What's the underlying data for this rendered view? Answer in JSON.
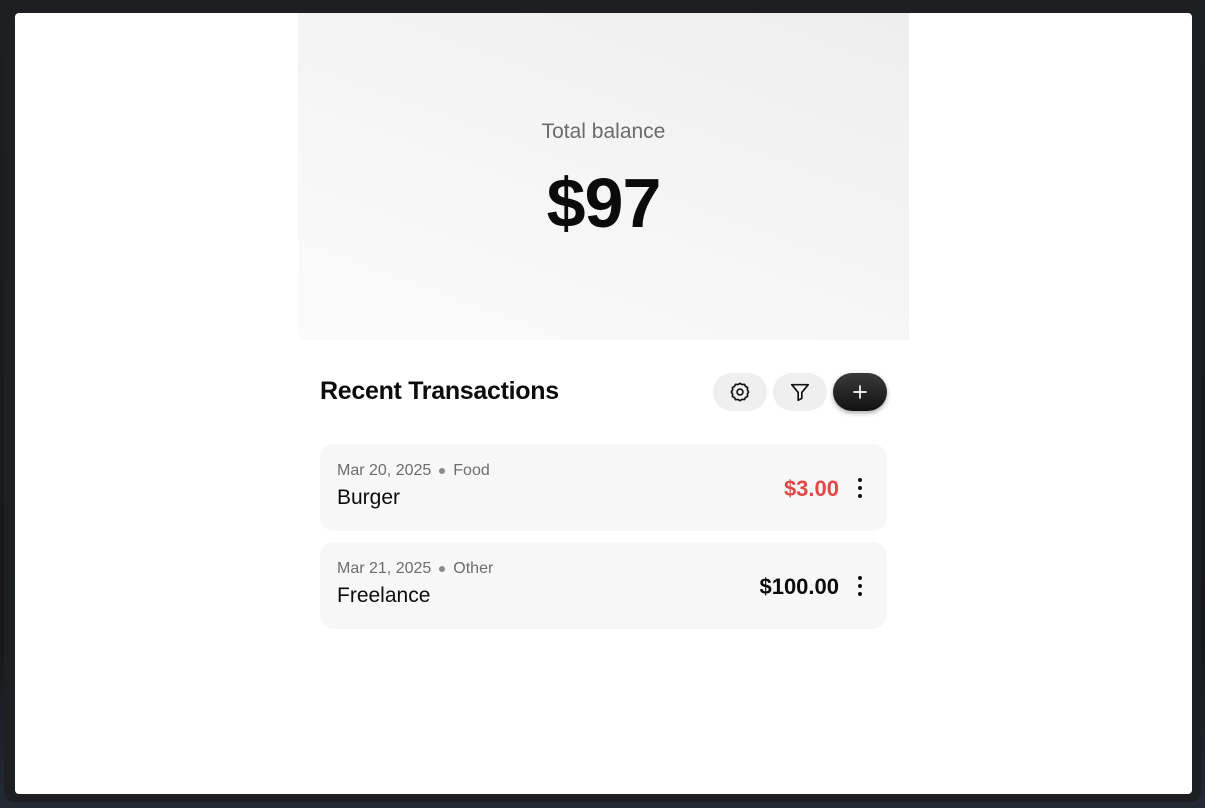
{
  "balance": {
    "label": "Total balance",
    "amount": "$97"
  },
  "transactions_section": {
    "title": "Recent Transactions",
    "toolbar": {
      "settings_icon": "settings-gear-icon",
      "filter_icon": "filter-funnel-icon",
      "add_icon": "plus-icon"
    },
    "items": [
      {
        "date": "Mar 20, 2025",
        "category": "Food",
        "name": "Burger",
        "amount": "$3.00",
        "type": "expense",
        "amount_color": "#e24848",
        "menu_icon": "more-vertical-icon"
      },
      {
        "date": "Mar 21, 2025",
        "category": "Other",
        "name": "Freelance",
        "amount": "$100.00",
        "type": "income",
        "amount_color": "#0c0c0c",
        "menu_icon": "more-vertical-icon"
      }
    ]
  },
  "colors": {
    "accent_dark": "#121212",
    "expense": "#e24848",
    "card_bg": "#f7f7f7"
  }
}
